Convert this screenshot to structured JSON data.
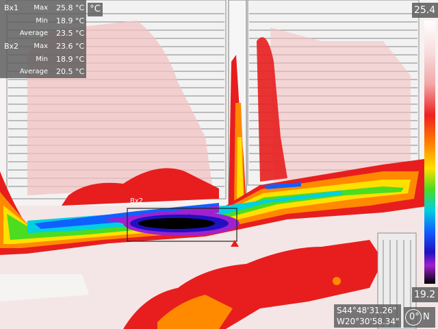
{
  "measurements": [
    {
      "box": "Bx1",
      "rows": [
        {
          "label": "Max",
          "value": "25.8 °C"
        },
        {
          "label": "Min",
          "value": "18.9 °C"
        },
        {
          "label": "Average",
          "value": "23.5 °C"
        }
      ]
    },
    {
      "box": "Bx2",
      "rows": [
        {
          "label": "Max",
          "value": "23.6 °C"
        },
        {
          "label": "Min",
          "value": "18.9 °C"
        },
        {
          "label": "Average",
          "value": "20.5 °C"
        }
      ]
    }
  ],
  "unit": "°C",
  "scale": {
    "max": "25.4",
    "min": "19.2"
  },
  "bx2_label": "Bx2",
  "gps": {
    "lat": "S44°48'31.26\"",
    "lon": "W20°30'58.34\""
  },
  "compass": {
    "heading": "0°",
    "dir": "N"
  },
  "colors": {
    "hot": "#ee2020",
    "cold": "#2010c0",
    "panel": "#5a5a5a"
  }
}
